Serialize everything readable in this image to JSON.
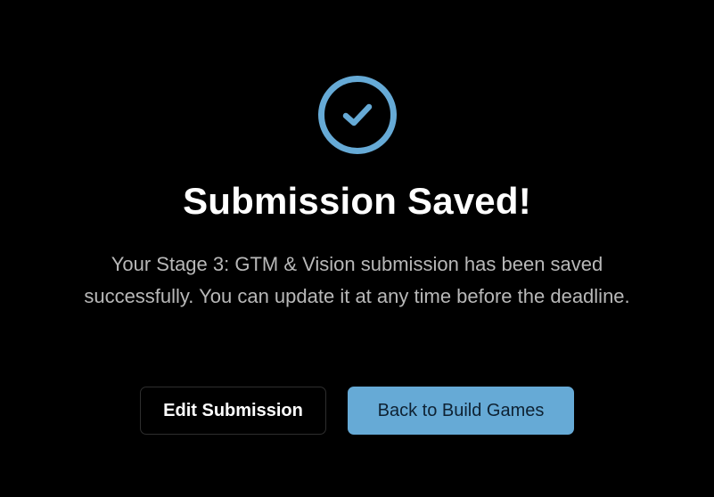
{
  "icon": {
    "name": "check-circle-icon",
    "color": "#66aad6"
  },
  "title": "Submission Saved!",
  "message": "Your Stage 3: GTM & Vision submission has been saved successfully. You can update it at any time before the deadline.",
  "buttons": {
    "edit_label": "Edit Submission",
    "back_label": "Back to Build Games"
  },
  "colors": {
    "background": "#000000",
    "accent": "#66aad6",
    "title": "#ffffff",
    "message": "#b8b8b8"
  }
}
